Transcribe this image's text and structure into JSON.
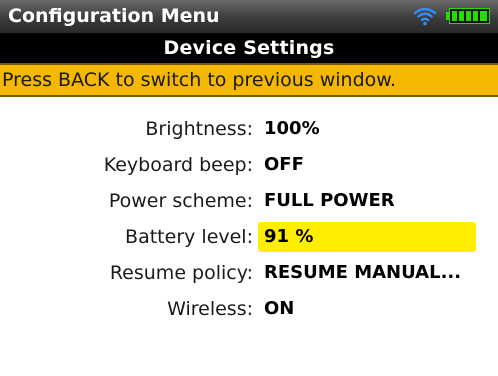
{
  "header": {
    "title": "Configuration Menu",
    "wifi_icon": "wifi-icon",
    "battery_icon": "battery-icon",
    "battery_color": "#22dd00"
  },
  "subheader": {
    "title": "Device Settings"
  },
  "banner": {
    "text": "Press BACK to switch to previous window.",
    "color": "#f5b800"
  },
  "settings": {
    "items": [
      {
        "label": "Brightness:",
        "value": "100%"
      },
      {
        "label": "Keyboard beep:",
        "value": "OFF"
      },
      {
        "label": "Power scheme:",
        "value": "FULL POWER"
      },
      {
        "label": "Battery level:",
        "value": "91 %",
        "selected": true
      },
      {
        "label": "Resume policy:",
        "value": "RESUME MANUAL..."
      },
      {
        "label": "Wireless:",
        "value": "ON"
      }
    ],
    "highlight_color": "#ffee00"
  }
}
